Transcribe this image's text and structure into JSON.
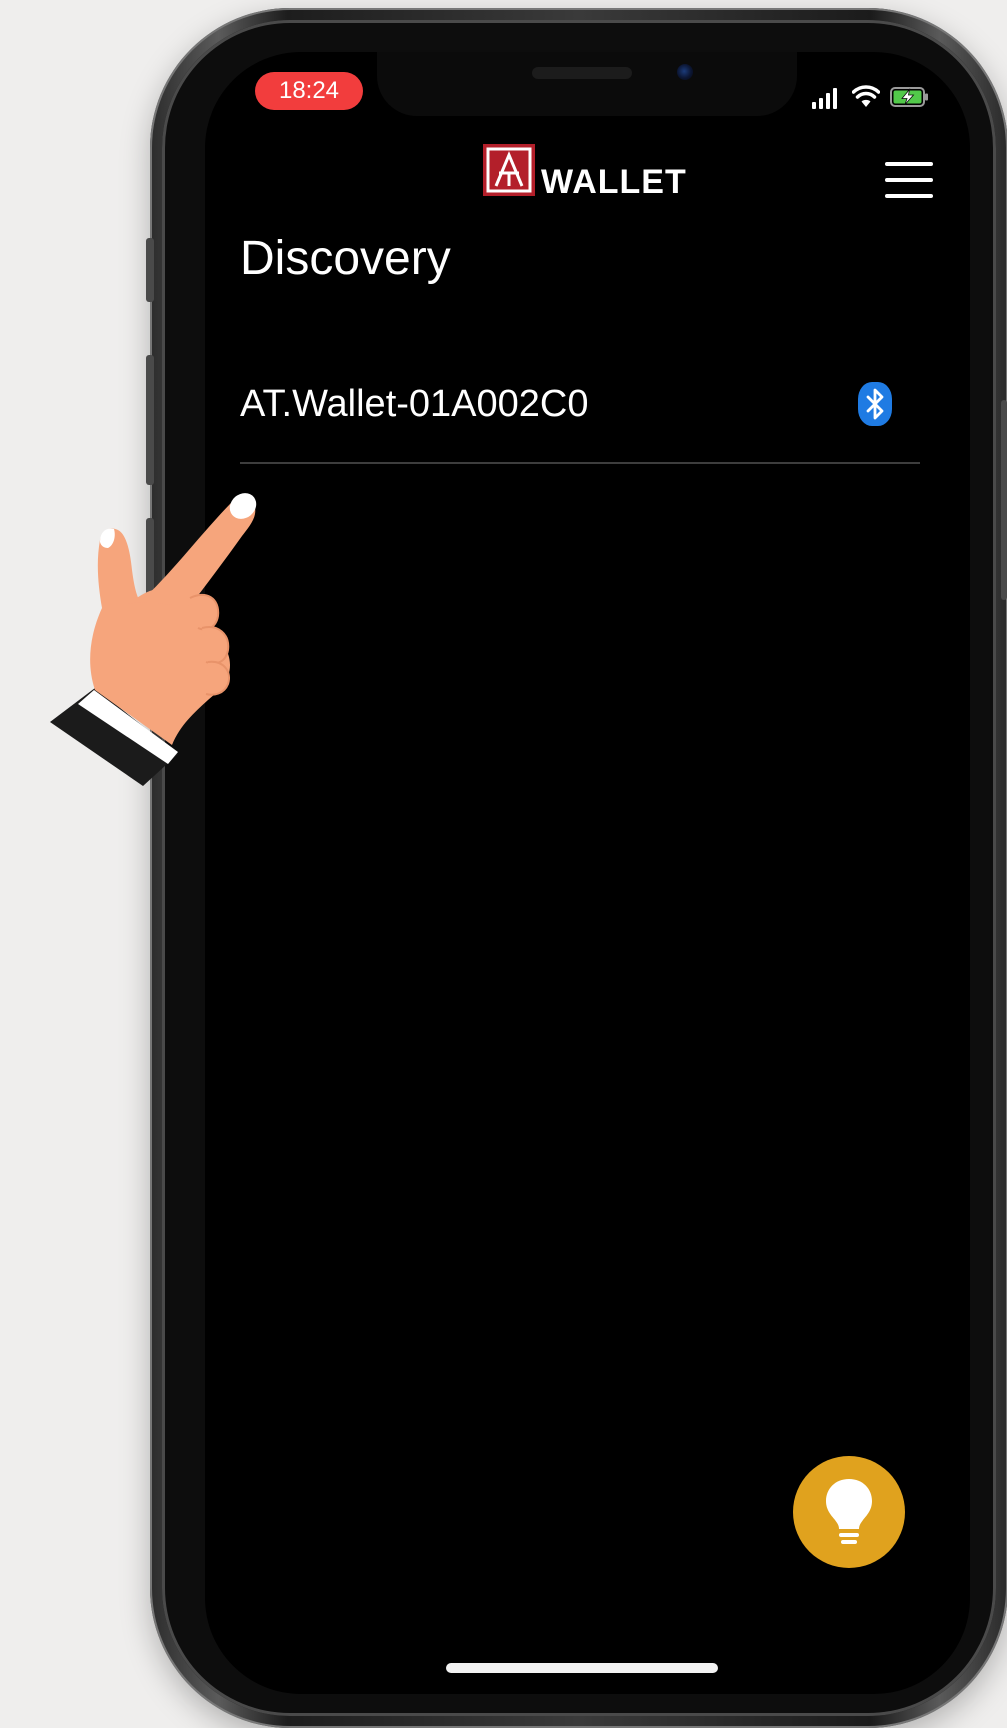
{
  "status_bar": {
    "time": "18:24",
    "icons": [
      "signal-icon",
      "wifi-icon",
      "battery-charging-icon"
    ]
  },
  "header": {
    "logo_text": "WALLET",
    "menu_icon": "hamburger-menu-icon"
  },
  "page": {
    "title": "Discovery"
  },
  "devices": [
    {
      "name": "AT.Wallet-01A002C0",
      "icon": "bluetooth-icon"
    }
  ],
  "fab": {
    "icon": "lightbulb-icon"
  },
  "colors": {
    "background": "#efeeed",
    "screen": "#000000",
    "time_pill": "#f23d3d",
    "logo_red": "#b31f2a",
    "bluetooth": "#1f7be3",
    "fab": "#e0a21e",
    "divider": "#3d3d3d"
  }
}
